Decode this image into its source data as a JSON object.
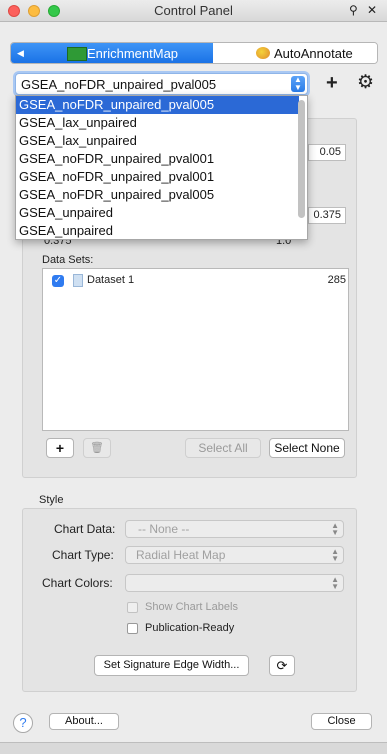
{
  "window": {
    "title": "Control Panel"
  },
  "tabs": [
    {
      "label": "EnrichmentMap",
      "active": true
    },
    {
      "label": "AutoAnnotate",
      "active": false
    }
  ],
  "network_select": {
    "value": "GSEA_noFDR_unpaired_pval005",
    "options": [
      "GSEA_noFDR_unpaired_pval005",
      "GSEA_lax_unpaired",
      "GSEA_lax_unpaired",
      "GSEA_noFDR_unpaired_pval001",
      "GSEA_noFDR_unpaired_pval001",
      "GSEA_noFDR_unpaired_pval005",
      "GSEA_unpaired",
      "GSEA_unpaired"
    ]
  },
  "filters": {
    "pvalue_field": "0.05",
    "similarity_field": "0.375",
    "slider_min": "0.375",
    "slider_max": "1.0"
  },
  "datasets": {
    "label": "Data Sets:",
    "items": [
      {
        "name": "Dataset 1",
        "count": "285",
        "checked": true
      }
    ]
  },
  "dataset_buttons": {
    "add": "+",
    "delete": "🗑",
    "select_all": "Select All",
    "select_none": "Select None"
  },
  "style": {
    "title": "Style",
    "chart_data_label": "Chart Data:",
    "chart_data_value": "-- None --",
    "chart_type_label": "Chart Type:",
    "chart_type_value": "Radial Heat Map",
    "chart_colors_label": "Chart Colors:",
    "chart_colors_value": "",
    "show_chart_labels": "Show Chart Labels",
    "publication_ready": "Publication-Ready",
    "sig_edge_button": "Set Signature Edge Width..."
  },
  "footer": {
    "help": "?",
    "about": "About...",
    "close": "Close"
  },
  "colors": {
    "accent": "#2b69d6",
    "tab_active": "#1a72e6"
  }
}
